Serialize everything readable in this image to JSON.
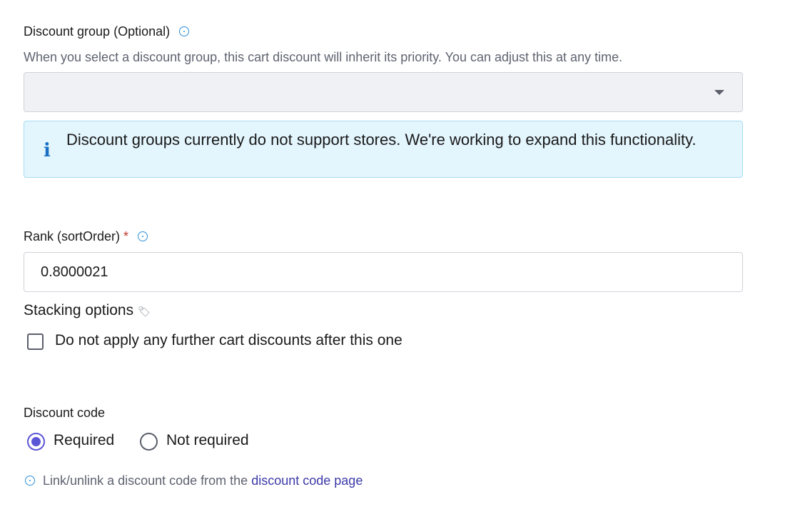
{
  "discount_group": {
    "label": "Discount group (Optional)",
    "help_text": "When you select a discount group, this cart discount will inherit its priority. You can adjust this at any time.",
    "selected_value": "",
    "info_banner": "Discount groups currently do not support stores. We're working to expand this functionality."
  },
  "rank": {
    "label": "Rank (sortOrder)",
    "required_marker": "*",
    "value": "0.8000021"
  },
  "stacking": {
    "label": "Stacking options",
    "checkbox_label": "Do not apply any further cart discounts after this one",
    "checked": false
  },
  "discount_code": {
    "label": "Discount code",
    "options": [
      {
        "label": "Required",
        "selected": true
      },
      {
        "label": "Not required",
        "selected": false
      }
    ],
    "footer_text": "Link/unlink a discount code from the",
    "footer_link": "discount code page"
  },
  "colors": {
    "accent": "#5b56d6",
    "info_icon": "#2f8fd8",
    "banner_bg": "#e3f5fd",
    "link": "#3d3aa8"
  }
}
